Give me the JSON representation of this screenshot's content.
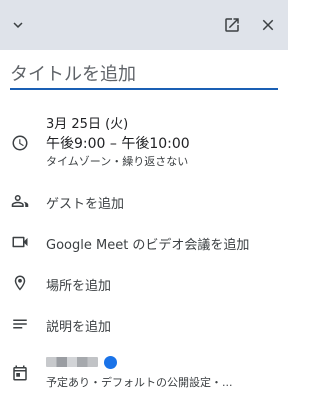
{
  "header": {
    "collapse_icon": "chevron-down-icon",
    "open_icon": "open-in-new-icon",
    "close_icon": "close-icon",
    "background": "#dfe3ea"
  },
  "title": {
    "placeholder": "タイトルを追加",
    "value": "",
    "underline_color": "#1a5fb4"
  },
  "datetime": {
    "icon": "clock-icon",
    "date": "3月 25日 (火)",
    "time": "午後9:00 – 午後10:00",
    "options": "タイムゾーン・繰り返さない"
  },
  "guests": {
    "icon": "people-icon",
    "label": "ゲストを追加"
  },
  "meet": {
    "icon": "video-camera-icon",
    "label": "Google Meet のビデオ会議を追加"
  },
  "location": {
    "icon": "location-pin-icon",
    "label": "場所を追加"
  },
  "description": {
    "icon": "notes-icon",
    "label": "説明を追加"
  },
  "calendar": {
    "icon": "calendar-icon",
    "color": "#1a73e8",
    "details": "予定あり・デフォルトの公開設定・..."
  }
}
